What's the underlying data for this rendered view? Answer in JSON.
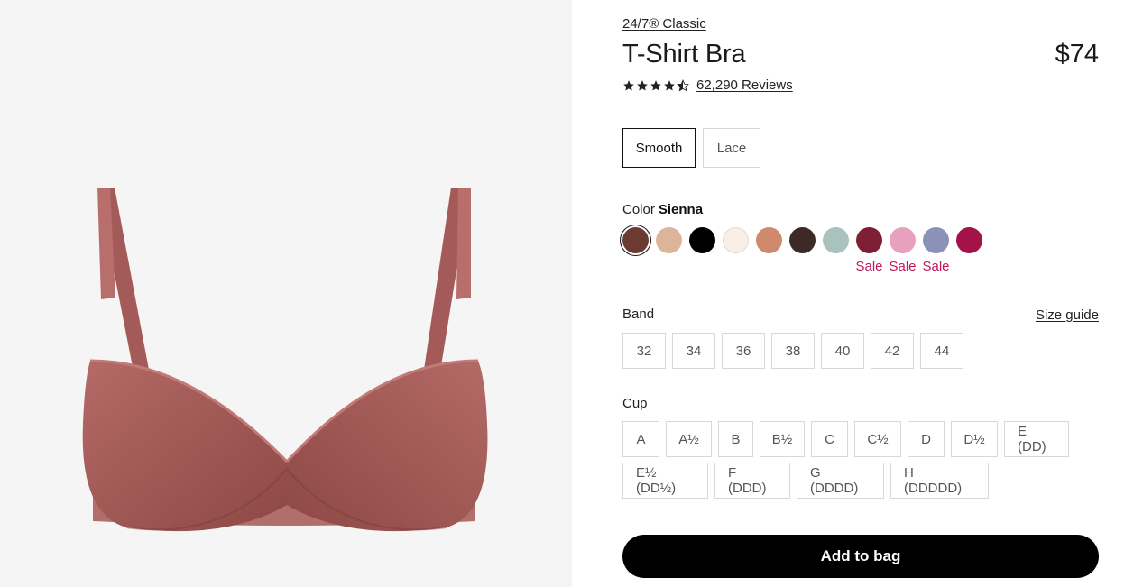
{
  "product": {
    "collection": "24/7® Classic",
    "title": "T-Shirt Bra",
    "price": "$74",
    "rating": 4.5,
    "reviews": "62,290 Reviews",
    "image_color": "#a85e5c"
  },
  "styles": {
    "options": [
      "Smooth",
      "Lace"
    ],
    "selected": "Smooth"
  },
  "color": {
    "label": "Color",
    "selected_name": "Sienna",
    "swatches": [
      {
        "hex": "#6b3a32",
        "selected": true
      },
      {
        "hex": "#dcb49a"
      },
      {
        "hex": "#000000"
      },
      {
        "hex": "#fbeee6"
      },
      {
        "hex": "#cf8a6e"
      },
      {
        "hex": "#3d2a28"
      },
      {
        "hex": "#a9c2bd"
      },
      {
        "hex": "#7f1f35",
        "sale": "Sale"
      },
      {
        "hex": "#e7a0bd",
        "sale": "Sale"
      },
      {
        "hex": "#8c91b8",
        "sale": "Sale"
      },
      {
        "hex": "#a3134a"
      }
    ]
  },
  "band": {
    "label": "Band",
    "size_guide": "Size guide",
    "options": [
      "32",
      "34",
      "36",
      "38",
      "40",
      "42",
      "44"
    ]
  },
  "cup": {
    "label": "Cup",
    "row1": [
      "A",
      "A½",
      "B",
      "B½",
      "C",
      "C½",
      "D",
      "D½",
      "E (DD)"
    ],
    "row2": [
      "E½ (DD½)",
      "F (DDD)",
      "G (DDDD)",
      "H (DDDDD)"
    ]
  },
  "actions": {
    "add_to_bag": "Add to bag"
  },
  "colors": {
    "sale": "#c2185b",
    "primary_button": "#000000"
  }
}
